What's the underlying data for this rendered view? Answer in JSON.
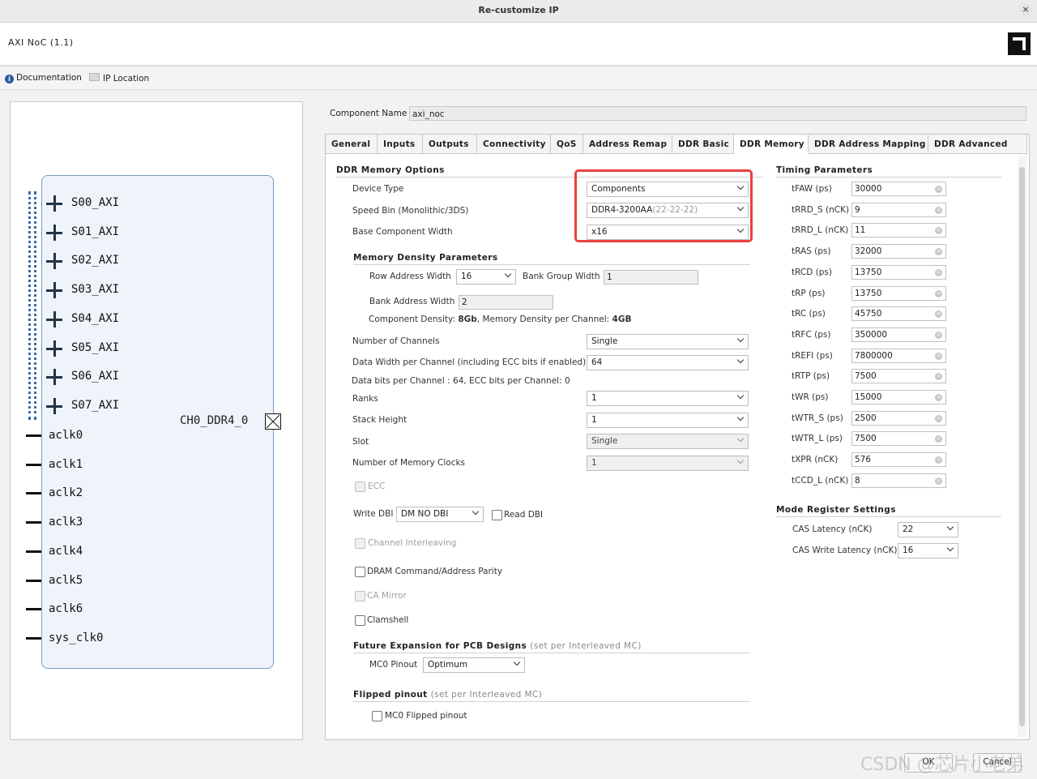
{
  "window": {
    "title": "Re-customize IP",
    "close": "×"
  },
  "ip": {
    "name": "AXI NoC (1.1)"
  },
  "links": {
    "documentation": "Documentation",
    "ip_location": "IP Location"
  },
  "block": {
    "axi_ports": [
      "S00_AXI",
      "S01_AXI",
      "S02_AXI",
      "S03_AXI",
      "S04_AXI",
      "S05_AXI",
      "S06_AXI",
      "S07_AXI"
    ],
    "clock_ports": [
      "aclk0",
      "aclk1",
      "aclk2",
      "aclk3",
      "aclk4",
      "aclk5",
      "aclk6",
      "sys_clk0"
    ],
    "output_port": "CH0_DDR4_0"
  },
  "component": {
    "label": "Component Name",
    "value": "axi_noc"
  },
  "tabs": [
    "General",
    "Inputs",
    "Outputs",
    "Connectivity",
    "QoS",
    "Address Remap",
    "DDR Basic",
    "DDR Memory",
    "DDR Address Mapping",
    "DDR Advanced"
  ],
  "active_tab": "DDR Memory",
  "ddr_options": {
    "title": "DDR Memory Options",
    "device_type": {
      "label": "Device Type",
      "value": "Components"
    },
    "speed_bin": {
      "label": "Speed Bin (Monolithic/3DS)",
      "value": "DDR4-3200AA",
      "suffix": "(22-22-22)"
    },
    "base_width": {
      "label": "Base Component Width",
      "value": "x16"
    }
  },
  "density": {
    "title": "Memory Density Parameters",
    "row_addr": {
      "label": "Row Address Width",
      "value": "16"
    },
    "bank_group": {
      "label": "Bank Group Width",
      "value": "1"
    },
    "bank_addr": {
      "label": "Bank Address Width",
      "value": "2"
    },
    "summary_a": "Component Density: ",
    "summary_b": "8Gb",
    "summary_c": ", Memory Density per Channel: ",
    "summary_d": "4GB"
  },
  "channels": {
    "label": "Number of Channels",
    "value": "Single"
  },
  "data_width": {
    "label": "Data Width per Channel (including ECC bits if enabled)",
    "value": "64"
  },
  "data_bits_note": "Data bits per Channel : 64, ECC bits per Channel: 0",
  "ranks": {
    "label": "Ranks",
    "value": "1"
  },
  "stack": {
    "label": "Stack Height",
    "value": "1"
  },
  "slot": {
    "label": "Slot",
    "value": "Single"
  },
  "mem_clocks": {
    "label": "Number of Memory Clocks",
    "value": "1"
  },
  "ecc": "ECC",
  "write_dbi": {
    "label": "Write DBI",
    "value": "DM NO DBI"
  },
  "read_dbi": "Read DBI",
  "channel_interleaving": "Channel Interleaving",
  "dram_parity": "DRAM Command/Address Parity",
  "ca_mirror": "CA Mirror",
  "clamshell": "Clamshell",
  "future": {
    "title": "Future Expansion for PCB Designs",
    "note": "(set per Interleaved MC)",
    "pinout_label": "MC0 Pinout",
    "pinout_value": "Optimum"
  },
  "flipped": {
    "title": "Flipped pinout",
    "note": "(set per Interleaved MC)",
    "checkbox": "MC0 Flipped pinout"
  },
  "timing": {
    "title": "Timing Parameters",
    "params": [
      {
        "label": "tFAW (ps)",
        "value": "30000"
      },
      {
        "label": "tRRD_S (nCK)",
        "value": "9"
      },
      {
        "label": "tRRD_L (nCK)",
        "value": "11"
      },
      {
        "label": "tRAS (ps)",
        "value": "32000"
      },
      {
        "label": "tRCD (ps)",
        "value": "13750"
      },
      {
        "label": "tRP (ps)",
        "value": "13750"
      },
      {
        "label": "tRC (ps)",
        "value": "45750"
      },
      {
        "label": "tRFC (ps)",
        "value": "350000"
      },
      {
        "label": "tREFI (ps)",
        "value": "7800000"
      },
      {
        "label": "tRTP (ps)",
        "value": "7500"
      },
      {
        "label": "tWR (ps)",
        "value": "15000"
      },
      {
        "label": "tWTR_S (ps)",
        "value": "2500"
      },
      {
        "label": "tWTR_L (ps)",
        "value": "7500"
      },
      {
        "label": "tXPR (nCK)",
        "value": "576"
      },
      {
        "label": "tCCD_L (nCK)",
        "value": "8"
      }
    ]
  },
  "mode_register": {
    "title": "Mode Register Settings",
    "cas_latency": {
      "label": "CAS Latency (nCK)",
      "value": "22"
    },
    "cas_write": {
      "label": "CAS Write Latency (nCK)",
      "value": "16"
    }
  },
  "buttons": {
    "ok": "OK",
    "cancel": "Cancel"
  },
  "watermark": "CSDN @芯片小老弟",
  "colors": {
    "highlight": "#e8413f",
    "port_pin": "#3a6aa8",
    "block_fill": "#eef4fa"
  }
}
